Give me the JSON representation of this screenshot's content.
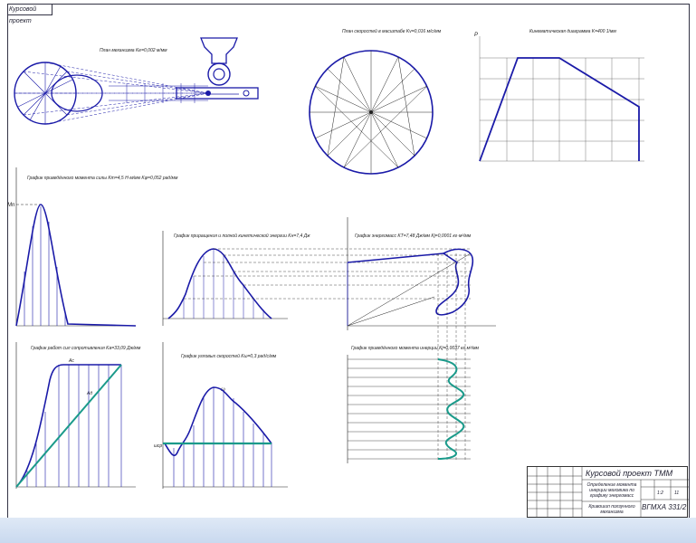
{
  "frame_note": "Курсовой проект",
  "panels": {
    "mechanism": {
      "title": "План механизма Ke=0,002 м/мм"
    },
    "velocity_plan": {
      "title": "План скоростей в масштабе Kv=0,016 м/с/мм"
    },
    "cam_diagram": {
      "title": "Кинематическая диаграмма K=400 1/мм",
      "axis_label": "P"
    },
    "moment_chart": {
      "title": "График приведённого момента силы Km=4,5 Н·м/мм   Kφ=0,052 рад/мм",
      "peak_label": "Mn"
    },
    "energy_chart": {
      "title": "График приращения и полной кинетической энергии Kн=7,4 Дж"
    },
    "energy_mass": {
      "title": "График энергомасс KT=7,48 Дж/мм  Kj=0,0001 кг·м²/мм"
    },
    "inertia_chart": {
      "title": "График приведённого момента инерции Kj=0,0037 кг·м²/мм"
    },
    "work_chart": {
      "title": "График работ сил сопротивления Kа=33,09 Дж/мм",
      "label_a": "Ac",
      "label_b": "Aд"
    },
    "omega_chart": {
      "title": "График угловых скоростей Kω=0,3 рад/с/мм",
      "label_omega": "ω",
      "label_omega_avg": "ωср"
    }
  },
  "title_block": {
    "project": "Курсовой проект ТММ",
    "description": "Определение момента инерции маховика по графику энергомасс",
    "description2": "Кривошип ползунного механизма",
    "code": "ВГМХА 331/2",
    "sheet": "1:2",
    "sheets": "11"
  },
  "colors": {
    "line": "#1a1aa8",
    "accent": "#1a9a8a",
    "frame": "#333344",
    "bar": "#c9d9ef"
  }
}
